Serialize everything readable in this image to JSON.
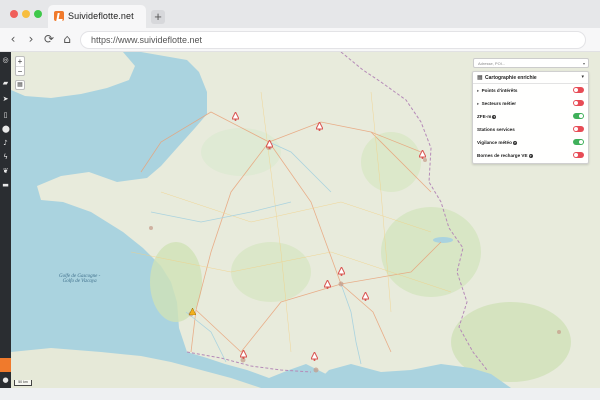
{
  "browser": {
    "tab_title": "Suivideflotte.net",
    "new_tab_label": "+",
    "url": "https://www.suivideflotte.net"
  },
  "map": {
    "zoom_in_label": "+",
    "zoom_out_label": "−",
    "search_placeholder": "Adresse, POI...",
    "scale_label": "50 km",
    "sea_labels": [
      "Golfe de Gascogne -",
      "Golfo de Vizcaya"
    ]
  },
  "panel": {
    "title": "Cartographie enrichie",
    "rows": [
      {
        "label": "Points d'intérêts",
        "expandable": true,
        "help": false,
        "enabled": false
      },
      {
        "label": "Secteurs métier",
        "expandable": true,
        "help": false,
        "enabled": false
      },
      {
        "label": "ZFE-m",
        "expandable": false,
        "help": true,
        "enabled": true
      },
      {
        "label": "Stations services",
        "expandable": false,
        "help": false,
        "enabled": false
      },
      {
        "label": "Vigilance météo",
        "expandable": false,
        "help": true,
        "enabled": true
      },
      {
        "label": "Bornes de recharge VE",
        "expandable": false,
        "help": true,
        "enabled": false
      }
    ]
  },
  "colors": {
    "accent": "#f07a2c",
    "sidebar": "#2a2d31",
    "toggle_off": "#e74c56",
    "toggle_on": "#3fb05a",
    "sea": "#aad3df",
    "land": "#e6eadb",
    "marker": "#d9534f"
  },
  "icons": {
    "sidebar": [
      "logo-icon",
      "car-icon",
      "navigation-arrow-icon",
      "document-icon",
      "location-pin-icon",
      "bell-icon",
      "lightning-icon",
      "leaf-icon",
      "truck-icon"
    ],
    "sidebar_bottom": [
      "message-icon",
      "user-icon"
    ]
  }
}
